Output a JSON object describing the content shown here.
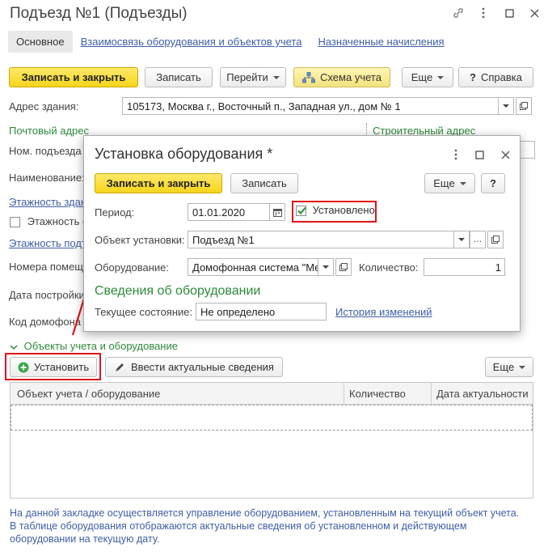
{
  "window": {
    "title": "Подъезд №1 (Подъезды)"
  },
  "tabs": [
    {
      "label": "Основное"
    },
    {
      "label": "Взаимосвязь оборудования и объектов учета"
    },
    {
      "label": "Назначенные начисления"
    }
  ],
  "toolbar": {
    "save_close": "Записать и закрыть",
    "save": "Записать",
    "go": "Перейти",
    "scheme": "Схема учета",
    "more": "Еще",
    "help": "Справка"
  },
  "form": {
    "address_label": "Адрес здания:",
    "address_value": "105173, Москва г., Восточный п., Западная ул., дом № 1",
    "postal_label": "Почтовый адрес",
    "build_label": "Строительный адрес",
    "entrance_no_label": "Ном. подъезда",
    "name_label": "Наименование:",
    "floors_link": "Этажность здан",
    "floors_check_label": "Этажность с",
    "floors_sub_link": "Этажность подт",
    "rooms_label": "Номера помещ",
    "build_date_label": "Дата постройки",
    "intercom_label": "Код домофона",
    "objects_section": "Объекты учета и оборудование"
  },
  "objects_toolbar": {
    "install": "Установить",
    "enter_info": "Ввести актуальные сведения",
    "more": "Еще"
  },
  "table": {
    "columns": [
      "Объект учета / оборудование",
      "Количество",
      "Дата актуальности"
    ]
  },
  "footer_text": "На данной закладке осуществляется управление оборудованием, установленным на текущий объект учета. В таблице оборудования отображаются актуальные сведения об установленном и действующем оборудовании на текущую дату.",
  "modal": {
    "title": "Установка оборудования *",
    "save_close": "Записать и закрыть",
    "save": "Записать",
    "more": "Еще",
    "help": "?",
    "period_label": "Период:",
    "period_value": "01.01.2020",
    "installed_label": "Установлено",
    "installed_checked": true,
    "object_label": "Объект установки:",
    "object_value": "Подъезд №1",
    "equipment_label": "Оборудование:",
    "equipment_value": "Домофонная система \"Ме",
    "qty_label": "Количество:",
    "qty_value": "1",
    "section_title": "Сведения об оборудовании",
    "state_label": "Текущее состояние:",
    "state_value": "Не определено",
    "history_link": "История изменений"
  },
  "colors": {
    "accent_yellow": "#f7d51b",
    "link_blue": "#3d5fa6",
    "section_green": "#2e8b3a",
    "highlight_red": "#e0141b"
  }
}
